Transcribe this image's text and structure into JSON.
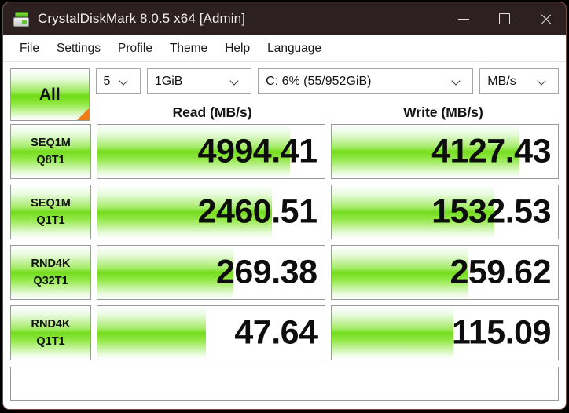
{
  "window": {
    "title": "CrystalDiskMark 8.0.5 x64 [Admin]",
    "icon": "disk-drive-icon",
    "controls": {
      "minimize": "minimize-icon",
      "maximize": "maximize-icon",
      "close": "close-icon"
    },
    "titlebar_color": "#2c2020",
    "border_color": "#7a4a42"
  },
  "menu": {
    "items": [
      {
        "label": "File"
      },
      {
        "label": "Settings"
      },
      {
        "label": "Profile"
      },
      {
        "label": "Theme"
      },
      {
        "label": "Help"
      },
      {
        "label": "Language"
      }
    ]
  },
  "toolbar": {
    "all_button_label": "All",
    "all_button_accent": "#f07c16",
    "count": "5",
    "size": "1GiB",
    "drive": "C: 6% (55/952GiB)",
    "unit": "MB/s"
  },
  "columns": {
    "read_header": "Read (MB/s)",
    "write_header": "Write (MB/s)"
  },
  "theme": {
    "bar_green": "#74dc1c",
    "bar_green_light": "#a4eb68"
  },
  "chart_data": {
    "type": "bar",
    "title": "CrystalDiskMark 8.0.5 x64 [Admin]",
    "xlabel": "",
    "ylabel": "MB/s",
    "categories": [
      "SEQ1M Q8T1",
      "SEQ1M Q1T1",
      "RND4K Q32T1",
      "RND4K Q1T1"
    ],
    "series": [
      {
        "name": "Read (MB/s)",
        "values": [
          4994.41,
          2460.51,
          269.38,
          47.64
        ]
      },
      {
        "name": "Write (MB/s)",
        "values": [
          4127.43,
          1532.53,
          259.62,
          115.09
        ]
      }
    ],
    "legend": "top",
    "grid": false
  },
  "results": {
    "rows": [
      {
        "name_line1": "SEQ1M",
        "name_line2": "Q8T1",
        "read": {
          "value": "4994.41",
          "fill_percent": 85
        },
        "write": {
          "value": "4127.43",
          "fill_percent": 83
        }
      },
      {
        "name_line1": "SEQ1M",
        "name_line2": "Q1T1",
        "read": {
          "value": "2460.51",
          "fill_percent": 77
        },
        "write": {
          "value": "1532.53",
          "fill_percent": 72
        }
      },
      {
        "name_line1": "RND4K",
        "name_line2": "Q32T1",
        "read": {
          "value": "269.38",
          "fill_percent": 60
        },
        "write": {
          "value": "259.62",
          "fill_percent": 60
        }
      },
      {
        "name_line1": "RND4K",
        "name_line2": "Q1T1",
        "read": {
          "value": "47.64",
          "fill_percent": 48
        },
        "write": {
          "value": "115.09",
          "fill_percent": 54
        }
      }
    ]
  },
  "comment": {
    "value": "",
    "placeholder": ""
  }
}
